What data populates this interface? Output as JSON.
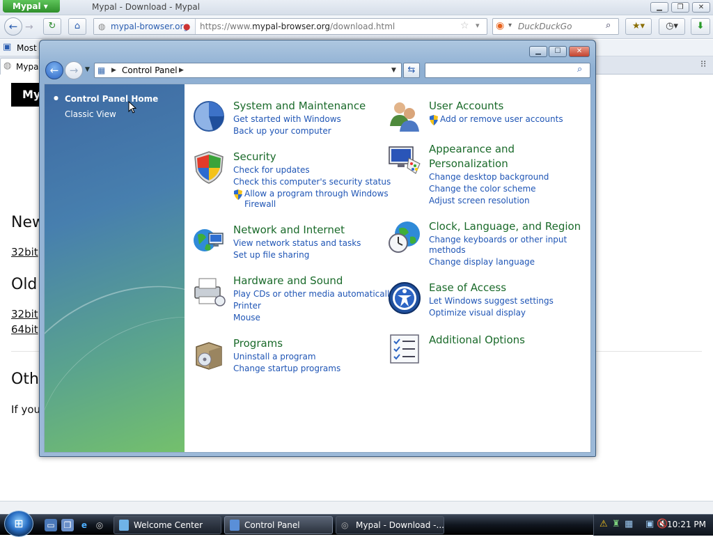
{
  "browser": {
    "app_menu": "Mypal",
    "window_title": "Mypal - Download - Mypal",
    "identity": "mypal-browser.org",
    "url_prefix": "https://www.",
    "url_domain": "mypal-browser.org",
    "url_path": "/download.html",
    "search_placeholder": "DuckDuckGo",
    "bookmark_item": "Most V",
    "tab_label": "Mypal",
    "page": {
      "logo_text": "My",
      "heading_new": "New",
      "link_32_new": "32bit",
      "heading_old": "Old",
      "link_32_old": "32bit",
      "link_64_old": "64bit",
      "heading_other": "Oth",
      "text_if": "If you"
    }
  },
  "control_panel": {
    "breadcrumb": "Control Panel",
    "nav": {
      "home": "Control Panel Home",
      "classic": "Classic View"
    },
    "categories_left": [
      {
        "title": "System and Maintenance",
        "links": [
          "Get started with Windows",
          "Back up your computer"
        ]
      },
      {
        "title": "Security",
        "links": [
          "Check for updates",
          "Check this computer's security status",
          "Allow a program through Windows",
          "Firewall"
        ]
      },
      {
        "title": "Network and Internet",
        "links": [
          "View network status and tasks",
          "Set up file sharing"
        ]
      },
      {
        "title": "Hardware and Sound",
        "links": [
          "Play CDs or other media automatically",
          "Printer",
          "Mouse"
        ]
      },
      {
        "title": "Programs",
        "links": [
          "Uninstall a program",
          "Change startup programs"
        ]
      }
    ],
    "categories_right": [
      {
        "title": "User Accounts",
        "links": [
          "Add or remove user accounts"
        ]
      },
      {
        "title": "Appearance and",
        "title2": "Personalization",
        "links": [
          "Change desktop background",
          "Change the color scheme",
          "Adjust screen resolution"
        ]
      },
      {
        "title": "Clock, Language, and Region",
        "links": [
          "Change keyboards or other input",
          "methods",
          "Change display language"
        ]
      },
      {
        "title": "Ease of Access",
        "links": [
          "Let Windows suggest settings",
          "Optimize visual display"
        ]
      },
      {
        "title": "Additional Options",
        "links": []
      }
    ]
  },
  "taskbar": {
    "buttons": [
      "Welcome Center",
      "Control Panel",
      "Mypal - Download -..."
    ],
    "clock": "10:21 PM"
  },
  "colors": {
    "category_title": "#1a6a2a",
    "link": "#1f55b5",
    "nav_gradient_top": "#3e6aa3",
    "nav_gradient_bottom": "#74c06c"
  }
}
